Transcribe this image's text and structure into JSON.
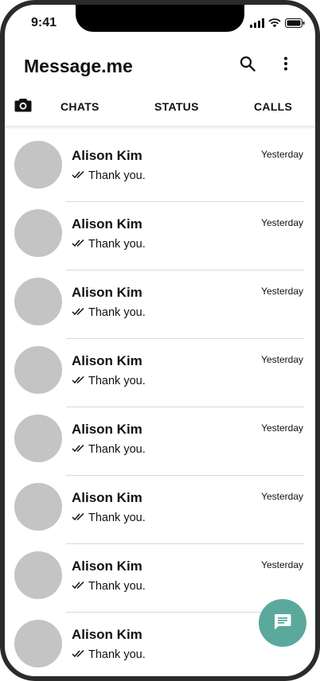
{
  "status_bar": {
    "time": "9:41",
    "icons": [
      "signal-icon",
      "wifi-icon",
      "battery-icon"
    ]
  },
  "header": {
    "title": "Message.me",
    "actions": [
      "search-icon",
      "more-vertical-icon"
    ]
  },
  "tabs": {
    "camera_icon": "camera-icon",
    "items": [
      {
        "label": "CHATS"
      },
      {
        "label": "STATUS"
      },
      {
        "label": "CALLS"
      }
    ]
  },
  "chats": [
    {
      "name": "Alison Kim",
      "message": "Thank you.",
      "time": "Yesterday",
      "read_icon": "double-check-icon"
    },
    {
      "name": "Alison Kim",
      "message": "Thank you.",
      "time": "Yesterday",
      "read_icon": "double-check-icon"
    },
    {
      "name": "Alison Kim",
      "message": "Thank you.",
      "time": "Yesterday",
      "read_icon": "double-check-icon"
    },
    {
      "name": "Alison Kim",
      "message": "Thank you.",
      "time": "Yesterday",
      "read_icon": "double-check-icon"
    },
    {
      "name": "Alison Kim",
      "message": "Thank you.",
      "time": "Yesterday",
      "read_icon": "double-check-icon"
    },
    {
      "name": "Alison Kim",
      "message": "Thank you.",
      "time": "Yesterday",
      "read_icon": "double-check-icon"
    },
    {
      "name": "Alison Kim",
      "message": "Thank you.",
      "time": "Yesterday",
      "read_icon": "double-check-icon"
    },
    {
      "name": "Alison Kim",
      "message": "Thank you.",
      "time": "",
      "read_icon": "double-check-icon"
    }
  ],
  "fab": {
    "icon": "message-icon"
  },
  "colors": {
    "accent": "#5aa99c",
    "avatar_placeholder": "#c4c4c4",
    "text": "#111111",
    "divider": "#d9d9d9"
  }
}
